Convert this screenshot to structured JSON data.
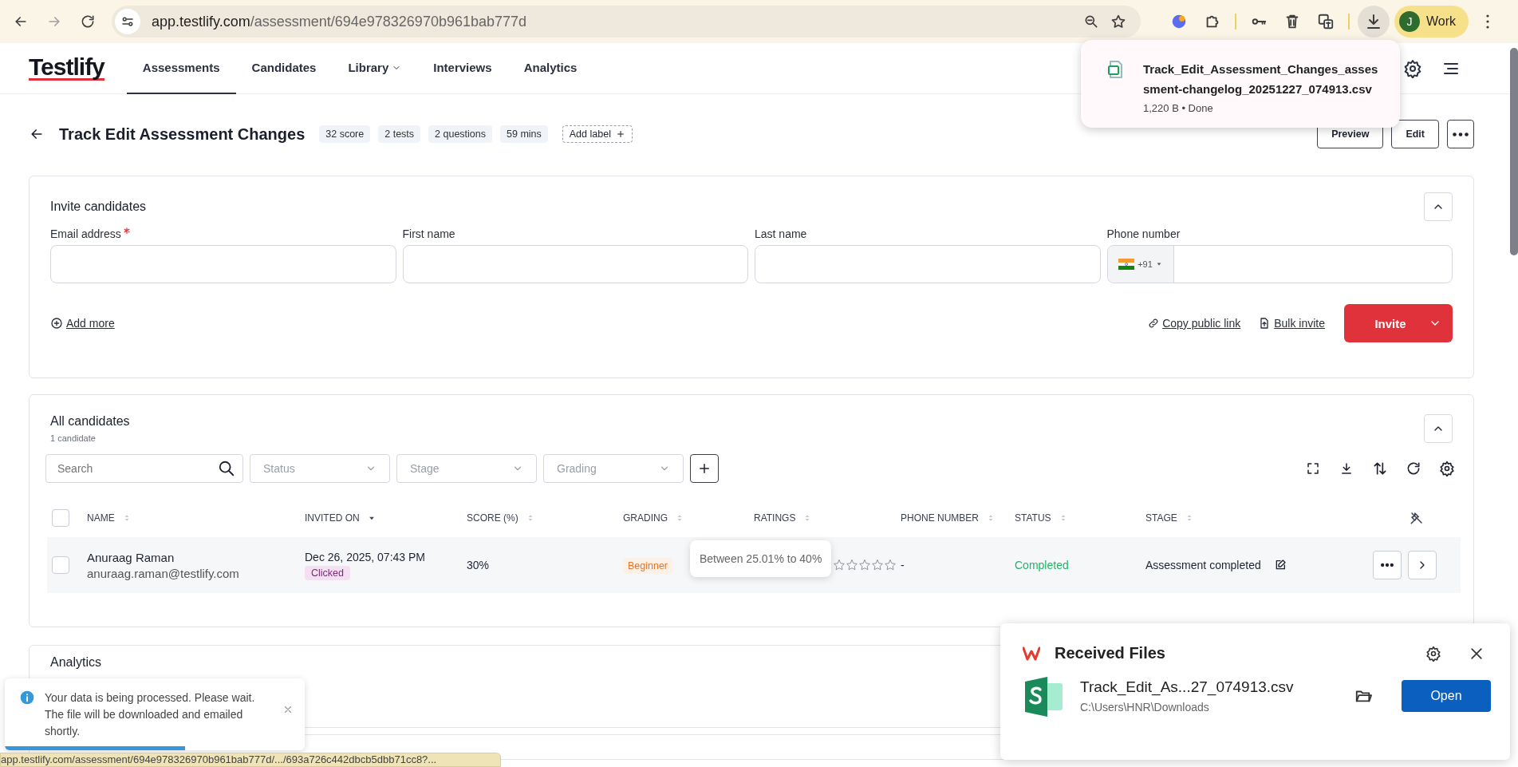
{
  "browser": {
    "url_host": "app.testlify.com",
    "url_path": "/assessment/694e978326970b961bab777d",
    "profile_initial": "J",
    "profile_label": "Work"
  },
  "nav": {
    "logo": "Testlify",
    "items": [
      {
        "label": "Assessments",
        "selected": true,
        "kind": "link"
      },
      {
        "label": "Candidates",
        "selected": false,
        "kind": "link"
      },
      {
        "label": "Library",
        "selected": false,
        "kind": "dropdown"
      },
      {
        "label": "Interviews",
        "selected": false,
        "kind": "link"
      },
      {
        "label": "Analytics",
        "selected": false,
        "kind": "link"
      }
    ]
  },
  "assessment": {
    "title": "Track Edit Assessment Changes",
    "tags": [
      "32 score",
      "2 tests",
      "2 questions",
      "59 mins"
    ],
    "add_label": "Add label",
    "actions": [
      "Preview",
      "Edit"
    ]
  },
  "invite": {
    "title": "Invite candidates",
    "fields": [
      {
        "label": "Email address",
        "required": true,
        "kind": "text"
      },
      {
        "label": "First name",
        "required": false,
        "kind": "text"
      },
      {
        "label": "Last name",
        "required": false,
        "kind": "text"
      },
      {
        "label": "Phone number",
        "required": false,
        "kind": "phone",
        "country_code": "+91"
      }
    ],
    "add_more": "Add more",
    "copy_link": "Copy public link",
    "bulk_invite": "Bulk invite",
    "invite_button": "Invite"
  },
  "candidates": {
    "title": "All candidates",
    "count": "1 candidate",
    "search_placeholder": "Search",
    "select_all_checked": false,
    "filters": [
      "Status",
      "Stage",
      "Grading"
    ],
    "columns": [
      {
        "label": "NAME",
        "sorted": false
      },
      {
        "label": "INVITED ON",
        "sorted": true
      },
      {
        "label": "SCORE (%)",
        "sorted": false
      },
      {
        "label": "GRADING",
        "sorted": false
      },
      {
        "label": "RATINGS",
        "sorted": false
      },
      {
        "label": "PHONE NUMBER",
        "sorted": false
      },
      {
        "label": "STATUS",
        "sorted": false
      },
      {
        "label": "STAGE",
        "sorted": false
      }
    ],
    "rows": [
      {
        "checked": false,
        "name": "Anuraag Raman",
        "email": "anuraag.raman@testlify.com",
        "invited_on": "Dec 26, 2025, 07:43 PM",
        "invite_status": "Clicked",
        "score": "30%",
        "grading": "Beginner",
        "stars": 0,
        "rating_tooltip": "Between 25.01% to 40%",
        "phone": "-",
        "status": "Completed",
        "stage": "Assessment completed"
      }
    ]
  },
  "analytics": {
    "title": "Analytics"
  },
  "download_popup": {
    "file_name": "Track_Edit_Assessment_Changes_assessment-changelog_20251227_074913.csv",
    "meta": "1,220 B • Done"
  },
  "toast": {
    "message": "Your data is being processed. Please wait. The file will be downloaded and emailed shortly.",
    "level": 0.6
  },
  "status_url": "app.testlify.com/assessment/694e978326970b961bab777d/.../693a726c442dbcb5dbb71cc8?...",
  "received_files": {
    "title": "Received Files",
    "file_name": "Track_Edit_As...27_074913.csv",
    "path": "C:\\Users\\HNR\\Downloads",
    "open_button": "Open"
  }
}
